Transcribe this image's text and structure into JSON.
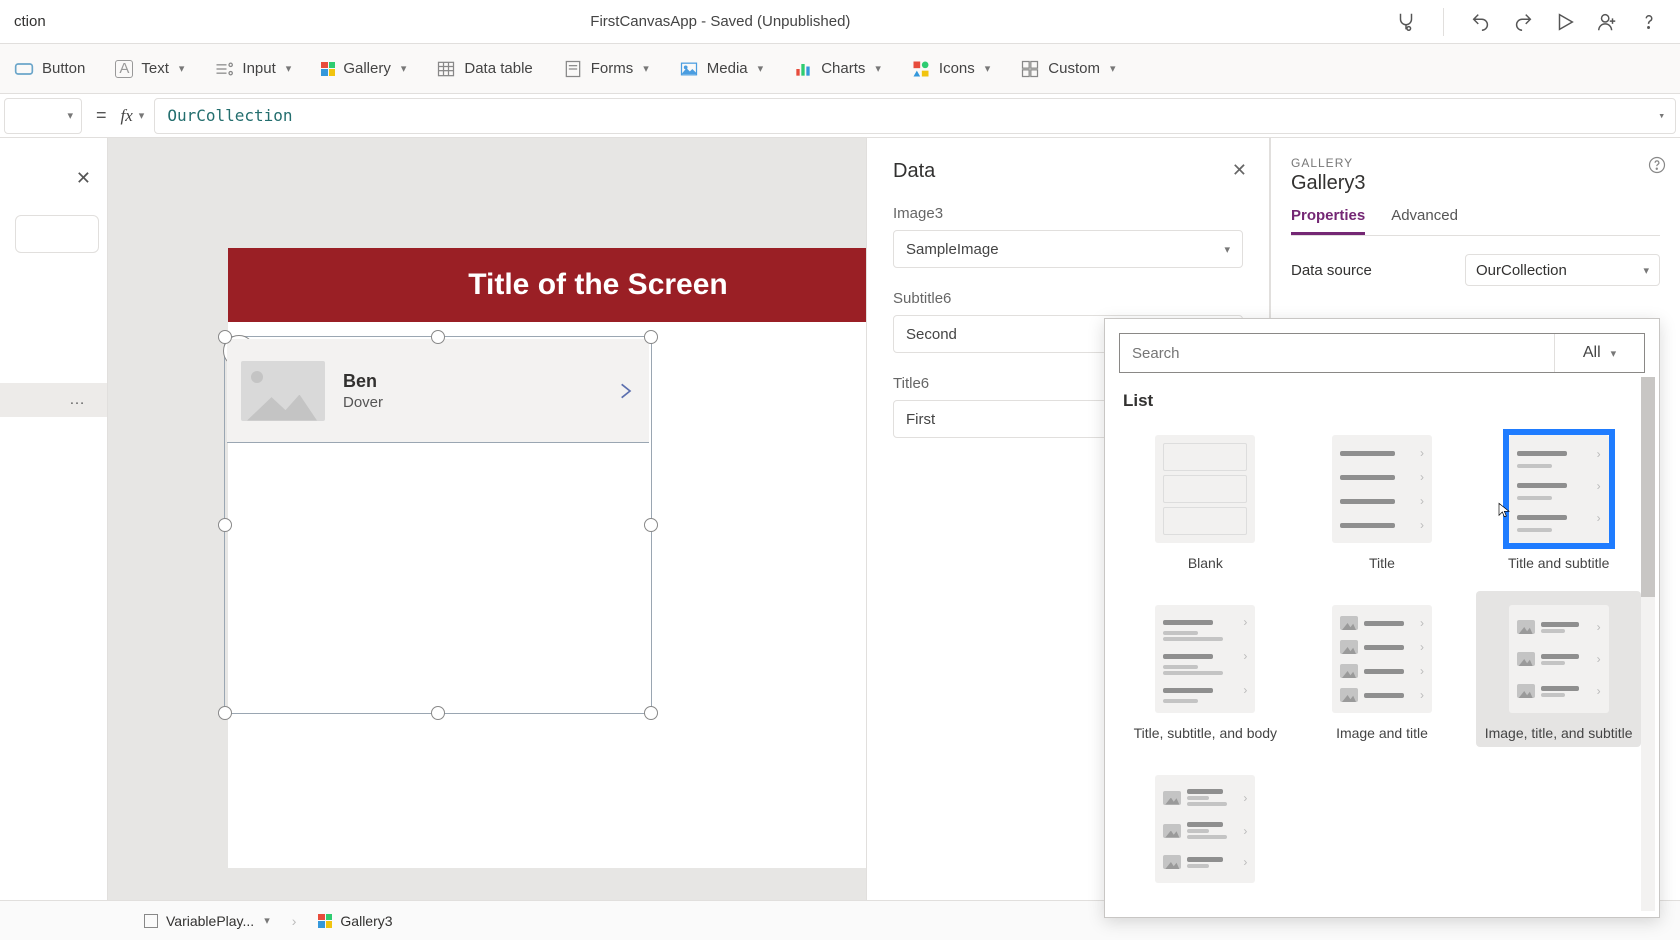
{
  "titleBar": {
    "leftLabel": "ction",
    "appTitle": "FirstCanvasApp - Saved (Unpublished)"
  },
  "ribbon": {
    "button": "Button",
    "text": "Text",
    "input": "Input",
    "gallery": "Gallery",
    "dataTable": "Data table",
    "forms": "Forms",
    "media": "Media",
    "charts": "Charts",
    "icons": "Icons",
    "custom": "Custom"
  },
  "formulaBar": {
    "fx": "fx",
    "value": "OurCollection"
  },
  "tree": {
    "ellipsis": "…"
  },
  "screen": {
    "headerTitle": "Title of the Screen",
    "record": {
      "title": "Ben",
      "subtitle": "Dover"
    }
  },
  "dataPanel": {
    "title": "Data",
    "fields": [
      {
        "label": "Image3",
        "value": "SampleImage"
      },
      {
        "label": "Subtitle6",
        "value": "Second"
      },
      {
        "label": "Title6",
        "value": "First"
      }
    ]
  },
  "propPanel": {
    "category": "GALLERY",
    "name": "Gallery3",
    "tabs": {
      "properties": "Properties",
      "advanced": "Advanced"
    },
    "dataSourceLabel": "Data source",
    "dataSourceValue": "OurCollection"
  },
  "layoutPicker": {
    "searchPlaceholder": "Search",
    "filterLabel": "All",
    "sectionTitle": "List",
    "items": [
      {
        "label": "Blank",
        "key": "blank"
      },
      {
        "label": "Title",
        "key": "title"
      },
      {
        "label": "Title and subtitle",
        "key": "title-subtitle",
        "highlighted": true
      },
      {
        "label": "Title, subtitle, and body",
        "key": "title-subtitle-body"
      },
      {
        "label": "Image and title",
        "key": "image-title"
      },
      {
        "label": "Image, title, and subtitle",
        "key": "image-title-subtitle",
        "selected": true
      },
      {
        "label": "",
        "key": "image-title-subtitle-body"
      }
    ]
  },
  "statusBar": {
    "crumb1": "VariablePlay...",
    "crumb2": "Gallery3"
  }
}
